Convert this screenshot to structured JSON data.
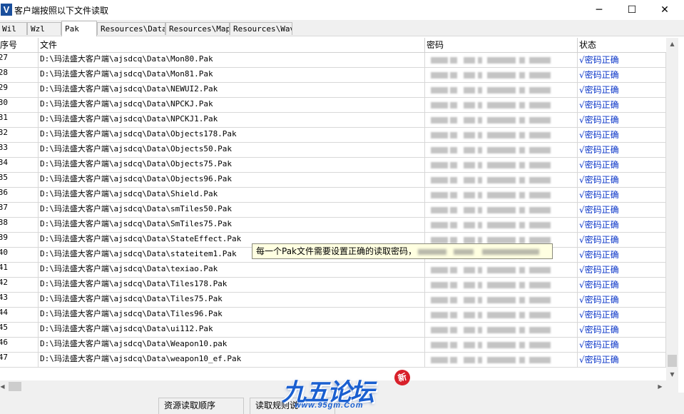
{
  "window": {
    "title": "客户端按照以下文件读取",
    "app_icon_letter": "V",
    "minimize": "─",
    "maximize": "☐",
    "close": "✕"
  },
  "tabs": [
    {
      "label": "Wil",
      "active": false
    },
    {
      "label": "Wzl",
      "active": false
    },
    {
      "label": "Pak",
      "active": true
    },
    {
      "label": "Resources\\Data",
      "active": false
    },
    {
      "label": "Resources\\Map",
      "active": false
    },
    {
      "label": "Resources\\Wav",
      "active": false
    }
  ],
  "grid": {
    "headers": {
      "num": "序号",
      "file": "文件",
      "password": "密码",
      "status": "状态"
    },
    "rows": [
      {
        "num": "27",
        "file": "D:\\玛法盛大客户端\\ajsdcq\\Data\\Mon80.Pak",
        "status": "√密码正确"
      },
      {
        "num": "28",
        "file": "D:\\玛法盛大客户端\\ajsdcq\\Data\\Mon81.Pak",
        "status": "√密码正确"
      },
      {
        "num": "29",
        "file": "D:\\玛法盛大客户端\\ajsdcq\\Data\\NEWUI2.Pak",
        "status": "√密码正确"
      },
      {
        "num": "30",
        "file": "D:\\玛法盛大客户端\\ajsdcq\\Data\\NPCKJ.Pak",
        "status": "√密码正确"
      },
      {
        "num": "31",
        "file": "D:\\玛法盛大客户端\\ajsdcq\\Data\\NPCKJ1.Pak",
        "status": "√密码正确"
      },
      {
        "num": "32",
        "file": "D:\\玛法盛大客户端\\ajsdcq\\Data\\Objects178.Pak",
        "status": "√密码正确"
      },
      {
        "num": "33",
        "file": "D:\\玛法盛大客户端\\ajsdcq\\Data\\Objects50.Pak",
        "status": "√密码正确"
      },
      {
        "num": "34",
        "file": "D:\\玛法盛大客户端\\ajsdcq\\Data\\Objects75.Pak",
        "status": "√密码正确"
      },
      {
        "num": "35",
        "file": "D:\\玛法盛大客户端\\ajsdcq\\Data\\Objects96.Pak",
        "status": "√密码正确"
      },
      {
        "num": "36",
        "file": "D:\\玛法盛大客户端\\ajsdcq\\Data\\Shield.Pak",
        "status": "√密码正确"
      },
      {
        "num": "37",
        "file": "D:\\玛法盛大客户端\\ajsdcq\\Data\\smTiles50.Pak",
        "status": "√密码正确"
      },
      {
        "num": "38",
        "file": "D:\\玛法盛大客户端\\ajsdcq\\Data\\SmTiles75.Pak",
        "status": "√密码正确"
      },
      {
        "num": "39",
        "file": "D:\\玛法盛大客户端\\ajsdcq\\Data\\StateEffect.Pak",
        "status": "√密码正确"
      },
      {
        "num": "40",
        "file": "D:\\玛法盛大客户端\\ajsdcq\\Data\\stateitem1.Pak",
        "status": "√密码正确"
      },
      {
        "num": "41",
        "file": "D:\\玛法盛大客户端\\ajsdcq\\Data\\texiao.Pak",
        "status": "√密码正确"
      },
      {
        "num": "42",
        "file": "D:\\玛法盛大客户端\\ajsdcq\\Data\\Tiles178.Pak",
        "status": "√密码正确"
      },
      {
        "num": "43",
        "file": "D:\\玛法盛大客户端\\ajsdcq\\Data\\Tiles75.Pak",
        "status": "√密码正确"
      },
      {
        "num": "44",
        "file": "D:\\玛法盛大客户端\\ajsdcq\\Data\\Tiles96.Pak",
        "status": "√密码正确"
      },
      {
        "num": "45",
        "file": "D:\\玛法盛大客户端\\ajsdcq\\Data\\ui112.Pak",
        "status": "√密码正确"
      },
      {
        "num": "46",
        "file": "D:\\玛法盛大客户端\\ajsdcq\\Data\\Weapon10.pak",
        "status": "√密码正确"
      },
      {
        "num": "47",
        "file": "D:\\玛法盛大客户端\\ajsdcq\\Data\\weapon10_ef.Pak",
        "status": "√密码正确"
      }
    ]
  },
  "tooltip": {
    "text": "每一个Pak文件需要设置正确的读取密码，"
  },
  "bottom_tabs": {
    "resource_order": "资源读取顺序",
    "read_rules": "读取规则说"
  },
  "watermark": {
    "title": "九五论坛",
    "url": "www.95gm.Com",
    "badge": "新"
  },
  "colors": {
    "status_text": "#0a35c8",
    "watermark": "#1a5fd0",
    "tooltip_bg": "#ffffe1"
  },
  "icons": {
    "scroll_up": "▲",
    "scroll_down": "▼",
    "scroll_left": "◀",
    "scroll_right": "▶"
  }
}
